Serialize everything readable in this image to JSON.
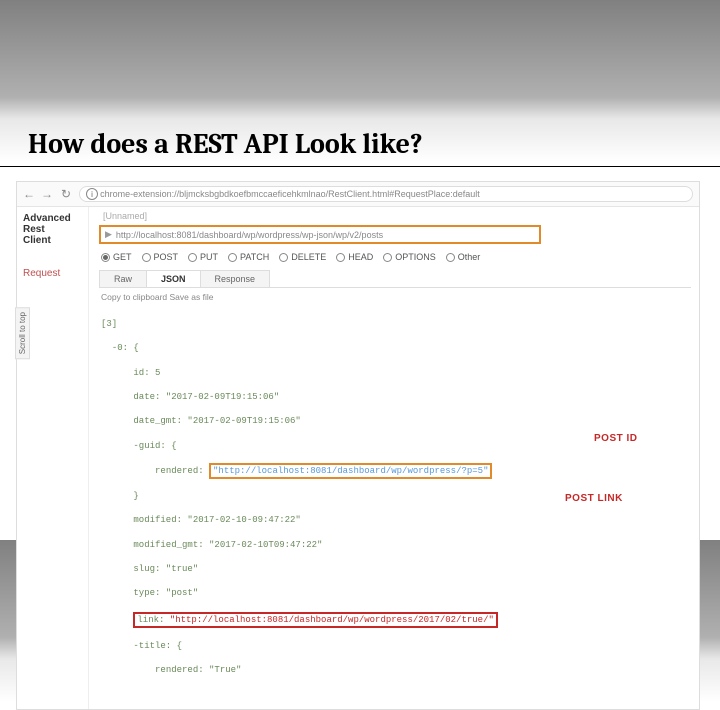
{
  "title": "How does a REST API Look like?",
  "browser": {
    "url": "chrome-extension://bljmcksbgbdkoefbmccaeficehkmlnao/RestClient.html#RequestPlace:default"
  },
  "sidebar": {
    "app_name_line1": "Advanced Rest",
    "app_name_line2": "Client",
    "request_link": "Request",
    "scroll_top": "Scroll to top"
  },
  "main": {
    "unnamed": "[Unnamed]",
    "endpoint_url": "http://localhost:8081/dashboard/wp/wordpress/wp-json/wp/v2/posts",
    "methods": {
      "get": "GET",
      "post": "POST",
      "put": "PUT",
      "patch": "PATCH",
      "delete": "DELETE",
      "head": "HEAD",
      "options": "OPTIONS",
      "other": "Other"
    },
    "tabs": {
      "raw": "Raw",
      "json": "JSON",
      "response": "Response"
    },
    "actions": "Copy to clipboard  Save as file"
  },
  "json": {
    "open": "[3]",
    "l_item": "-0: {",
    "l_id": "id: 5",
    "l_date": "date: \"2017-02-09T19:15:06\"",
    "l_date_gmt": "date_gmt: \"2017-02-09T19:15:06\"",
    "l_guid_open": "-guid: {",
    "guid_rendered_key": "rendered: ",
    "guid_rendered_val": "\"http://localhost:8081/dashboard/wp/wordpress/?p=5\"",
    "l_close1": "}",
    "l_modified": "modified: \"2017-02-10-09:47:22\"",
    "l_modified_gmt": "modified_gmt: \"2017-02-10T09:47:22\"",
    "l_slug": "slug: \"true\"",
    "l_type": "type: \"post\"",
    "link_key": "link: ",
    "link_val": "\"http://localhost:8081/dashboard/wp/wordpress/2017/02/true/\"",
    "l_title_open": "-title: {",
    "l_title_rendered": "rendered: \"True\""
  },
  "annotations": {
    "post_id": "POST ID",
    "post_link": "POST LINK"
  }
}
